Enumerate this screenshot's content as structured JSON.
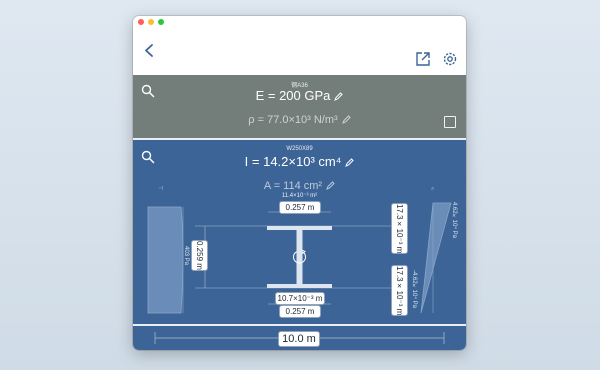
{
  "window": {
    "traffic_lights": [
      "close",
      "minimize",
      "zoom"
    ]
  },
  "navbar": {
    "back_icon": "chevron-left-icon",
    "share_icon": "share-icon",
    "settings_icon": "gear-icon"
  },
  "material": {
    "name": "钢A36",
    "elastic_modulus": "E = 200 GPa",
    "density": "ρ = 77.0×10³ N/m³"
  },
  "section": {
    "name": "W250X89",
    "inertia": "I = 14.2×10³ cm⁴",
    "area": "A = 114 cm²",
    "area_small": "11.4×10⁻³ m²",
    "flange_width_top": "0.257 m",
    "flange_width_bottom": "0.257 m",
    "depth": "0.259 m",
    "web_thickness": "10.7×10⁻³ m",
    "flange_thickness_top": "17.3×10⁻³ m",
    "flange_thickness_bottom": "17.3×10⁻³ m",
    "shear_stress": "403 Pa",
    "normal_stress_top": "4.62×10⁴ Pa",
    "normal_stress_bottom": "-4.62×10⁴ Pa"
  },
  "beam": {
    "length": "10.0 m"
  },
  "colors": {
    "navbar_bg": "#ffffff",
    "material_bg": "#737d79",
    "section_bg": "#3c6497",
    "accent": "#3c6497"
  }
}
